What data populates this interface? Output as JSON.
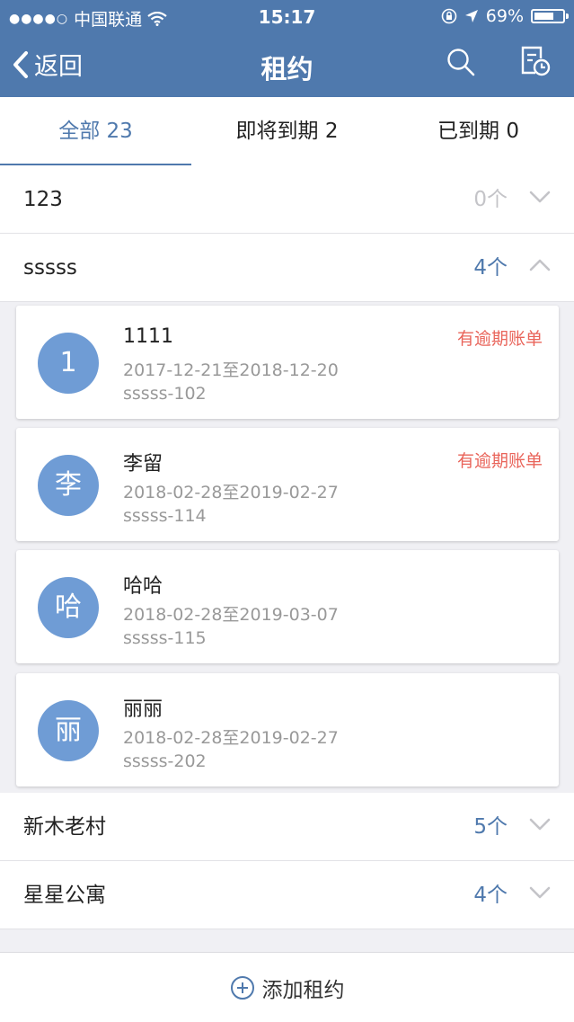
{
  "status_bar": {
    "signal": "●●●●○",
    "carrier": "中国联通",
    "time": "15:17",
    "battery_level": "69%",
    "battery_fraction": 0.69
  },
  "nav": {
    "back_label": "返回",
    "title": "租约",
    "search_icon": "search-icon",
    "history_icon": "document-clock-icon"
  },
  "tabs": [
    {
      "label": "全部 23",
      "active": true
    },
    {
      "label": "即将到期 2",
      "active": false
    },
    {
      "label": "已到期 0",
      "active": false
    }
  ],
  "groups": [
    {
      "name": "123",
      "count": "0个",
      "expanded": false
    },
    {
      "name": "sssss",
      "count": "4个",
      "expanded": true
    },
    {
      "name": "新木老村",
      "count": "5个",
      "expanded": false
    },
    {
      "name": "星星公寓",
      "count": "4个",
      "expanded": false
    }
  ],
  "leases": [
    {
      "avatar": "1",
      "name": "1111",
      "dates": "2017-12-21至2018-12-20",
      "room": "sssss-102",
      "flag": "有逾期账单"
    },
    {
      "avatar": "李",
      "name": "李留",
      "dates": "2018-02-28至2019-02-27",
      "room": "sssss-114",
      "flag": "有逾期账单"
    },
    {
      "avatar": "哈",
      "name": "哈哈",
      "dates": "2018-02-28至2019-03-07",
      "room": "sssss-115",
      "flag": ""
    },
    {
      "avatar": "丽",
      "name": "丽丽",
      "dates": "2018-02-28至2019-02-27",
      "room": "sssss-202",
      "flag": ""
    }
  ],
  "bottom": {
    "label": "添加租约",
    "icon": "plus-circle-icon"
  },
  "colors": {
    "header": "#4f79ad",
    "accent": "#4f79ad",
    "overdue": "#e9645a",
    "avatar": "#6f9cd5"
  }
}
